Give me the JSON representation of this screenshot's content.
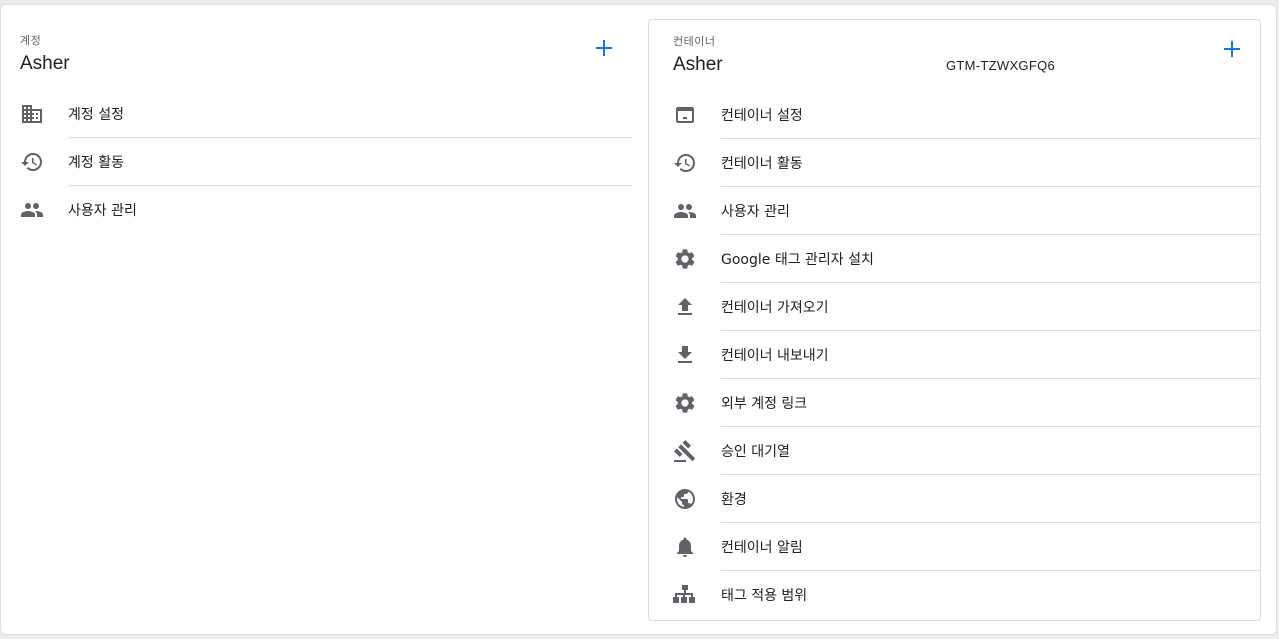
{
  "account": {
    "section_label": "계정",
    "name": "Asher",
    "items": [
      {
        "label": "계정 설정",
        "icon": "building-icon"
      },
      {
        "label": "계정 활동",
        "icon": "history-icon"
      },
      {
        "label": "사용자 관리",
        "icon": "people-icon"
      }
    ]
  },
  "container": {
    "section_label": "컨테이너",
    "name": "Asher",
    "public_id": "GTM-TZWXGFQ6",
    "items": [
      {
        "label": "컨테이너 설정",
        "icon": "web-asset-icon"
      },
      {
        "label": "컨테이너 활동",
        "icon": "history-icon"
      },
      {
        "label": "사용자 관리",
        "icon": "people-icon"
      },
      {
        "label": "Google 태그 관리자 설치",
        "icon": "gear-icon"
      },
      {
        "label": "컨테이너 가져오기",
        "icon": "upload-icon"
      },
      {
        "label": "컨테이너 내보내기",
        "icon": "download-icon"
      },
      {
        "label": "외부 계정 링크",
        "icon": "gear-icon"
      },
      {
        "label": "승인 대기열",
        "icon": "gavel-icon"
      },
      {
        "label": "환경",
        "icon": "globe-icon"
      },
      {
        "label": "컨테이너 알림",
        "icon": "bell-icon"
      },
      {
        "label": "태그 적용 범위",
        "icon": "sitemap-icon"
      }
    ]
  },
  "colors": {
    "accent": "#1a73e8",
    "icon": "#5f6368",
    "divider": "#dadce0"
  }
}
